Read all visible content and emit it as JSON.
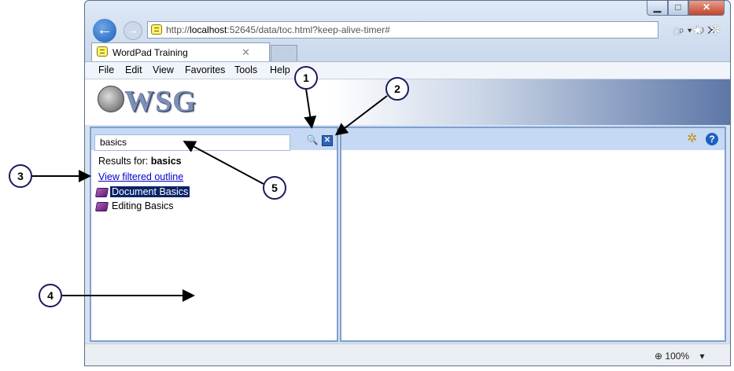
{
  "browser": {
    "address": {
      "prefix": "http://",
      "host": "localhost",
      "rest": ":52645/data/toc.html?keep-alive-timer#"
    },
    "address_tools": "⌕ ▾ ↻ ✕",
    "tab_title": "WordPad Training",
    "tab_close": "✕",
    "caption_buttons": {
      "minimize": "▁",
      "maximize": "□",
      "close": "✕"
    },
    "menu": [
      "File",
      "Edit",
      "View",
      "Favorites",
      "Tools",
      "Help"
    ],
    "icons": [
      "back-arrow-icon",
      "forward-arrow-icon",
      "home-icon",
      "favorites-star-icon",
      "gear-icon"
    ]
  },
  "banner": {
    "logo_text": "WSG"
  },
  "left_pane": {
    "search_value": "basics",
    "results_prefix": "Results for:",
    "results_term": "basics",
    "filtered_link": "View filtered outline",
    "items": [
      {
        "label": "Document Basics",
        "selected": true
      },
      {
        "label": "Editing Basics",
        "selected": false
      }
    ]
  },
  "status": {
    "zoom": "100%"
  },
  "callouts": [
    "1",
    "2",
    "3",
    "4",
    "5"
  ],
  "colors": {
    "accent": "#7f9fcf",
    "toolbar": "#c6d9f4",
    "link": "#0000cc",
    "selection": "#0a246a",
    "callout_border": "#1a1a60"
  }
}
